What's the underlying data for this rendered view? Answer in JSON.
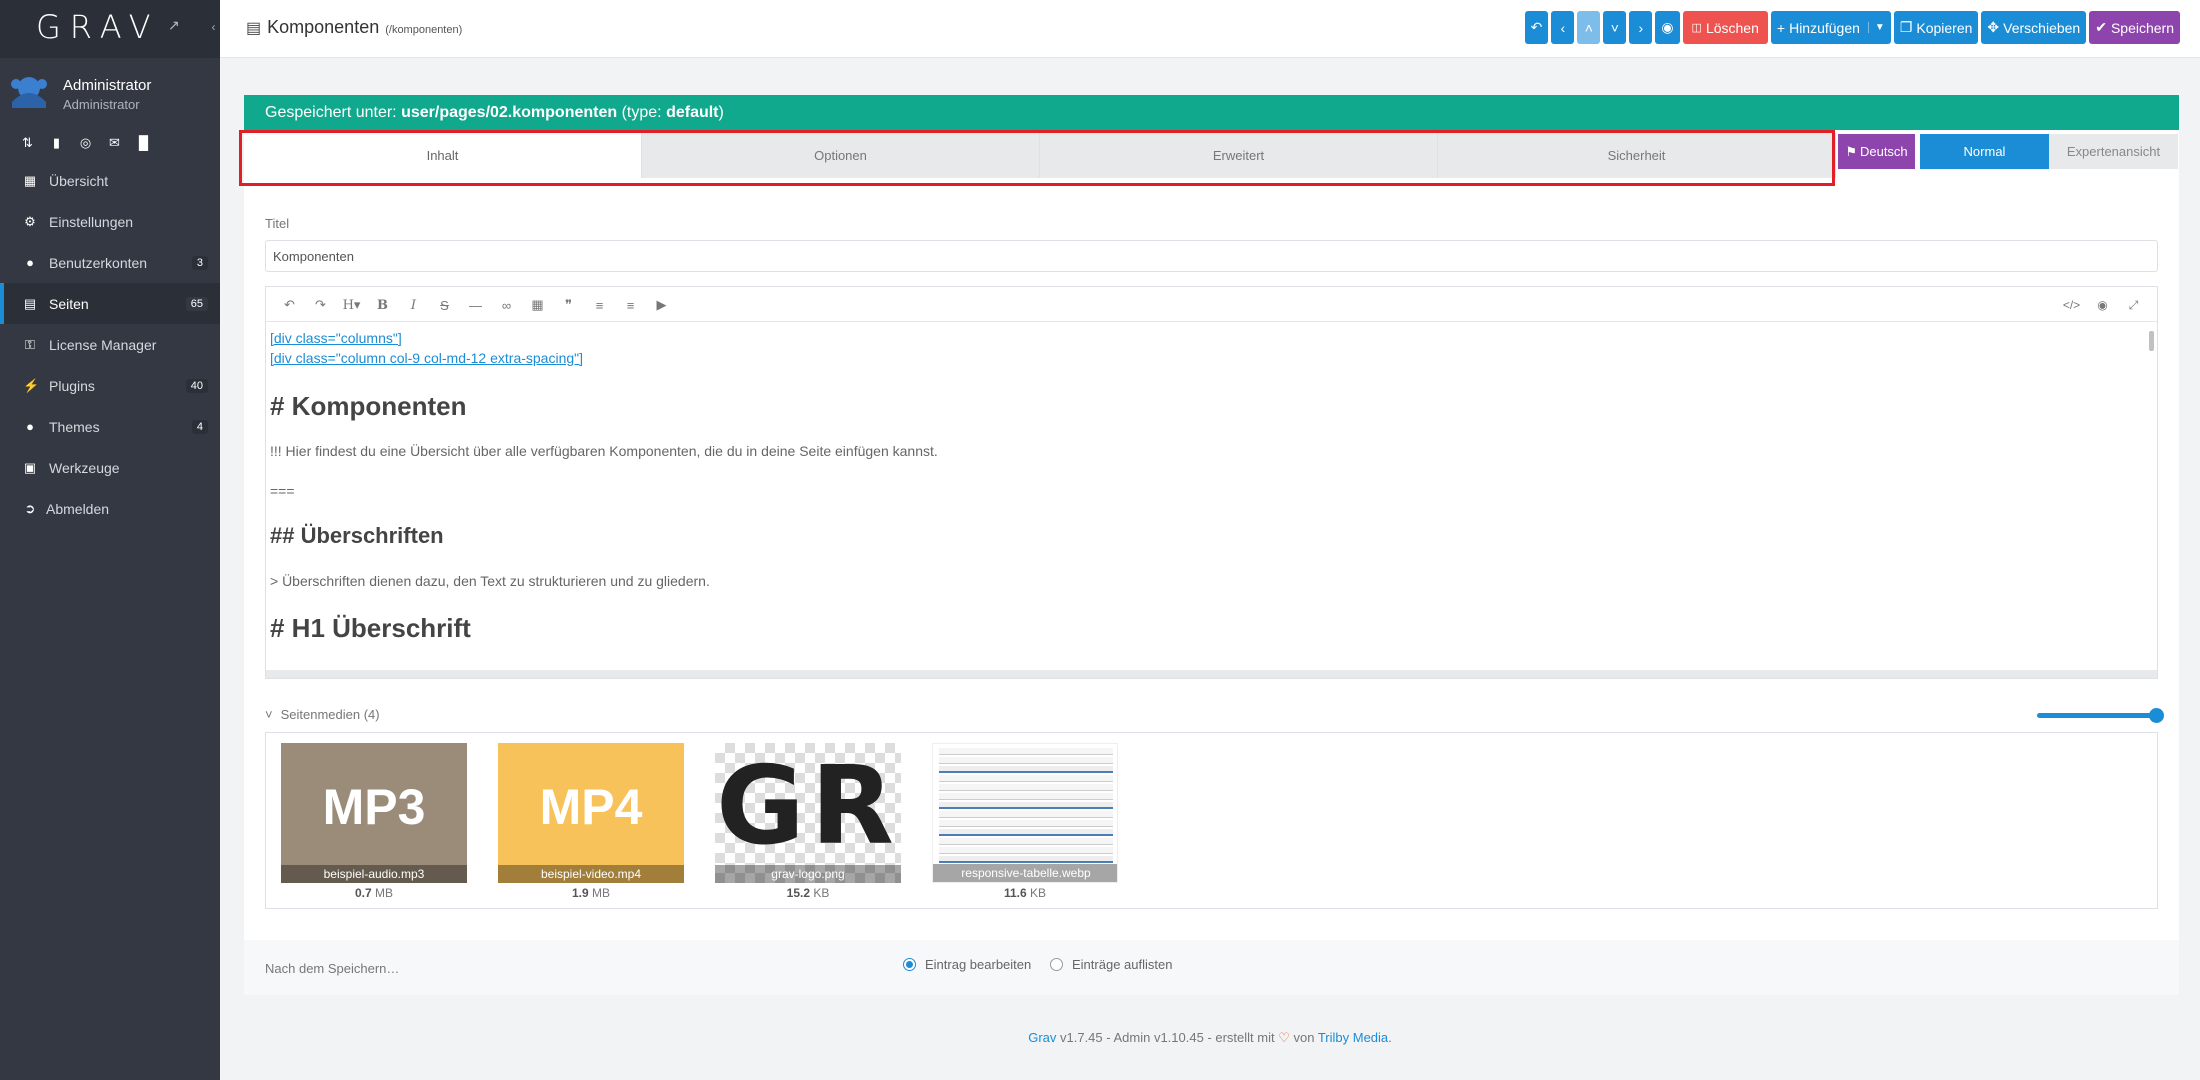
{
  "sidebar": {
    "logo": "GRAV",
    "user": {
      "name": "Administrator",
      "role": "Administrator"
    },
    "quick_icons": [
      "refresh-icon",
      "book-icon",
      "globe-icon",
      "mail-icon",
      "fork-icon"
    ],
    "items": [
      {
        "label": "Übersicht",
        "icon": "grid-icon",
        "count": ""
      },
      {
        "label": "Einstellungen",
        "icon": "wrench-icon",
        "count": ""
      },
      {
        "label": "Benutzerkonten",
        "icon": "users-icon",
        "count": "3"
      },
      {
        "label": "Seiten",
        "icon": "file-icon",
        "count": "65",
        "active": true
      },
      {
        "label": "License Manager",
        "icon": "key-icon",
        "count": ""
      },
      {
        "label": "Plugins",
        "icon": "plug-icon",
        "count": "40"
      },
      {
        "label": "Themes",
        "icon": "tint-icon",
        "count": "4"
      },
      {
        "label": "Werkzeuge",
        "icon": "briefcase-icon",
        "count": ""
      },
      {
        "label": "Abmelden",
        "icon": "sign-out-icon",
        "count": ""
      }
    ]
  },
  "topbar": {
    "title": "Komponenten",
    "route": "(/komponenten)",
    "buttons": {
      "delete": "Löschen",
      "add": "Hinzufügen",
      "copy": "Kopieren",
      "move": "Verschieben",
      "save": "Speichern"
    }
  },
  "saved": {
    "prefix": "Gespeichert unter:",
    "path": "user/pages/02.komponenten",
    "type_open": "(type:",
    "type": "default",
    "type_close": ")"
  },
  "tabs": [
    "Inhalt",
    "Optionen",
    "Erweitert",
    "Sicherheit"
  ],
  "language": "Deutsch",
  "modes": {
    "normal": "Normal",
    "expert": "Expertenansicht"
  },
  "title_field": {
    "label": "Titel",
    "value": "Komponenten"
  },
  "editor": {
    "lines": [
      {
        "type": "link",
        "text": "[div class=\"columns\"]"
      },
      {
        "type": "link",
        "text": "[div class=\"column col-9 col-md-12 extra-spacing\"]"
      },
      {
        "type": "h1",
        "text": "# Komponenten"
      },
      {
        "type": "p",
        "text": "!!! Hier findest du eine Übersicht über alle verfügbaren Komponenten, die du in deine Seite einfügen kannst."
      },
      {
        "type": "p",
        "text": "==="
      },
      {
        "type": "h2",
        "text": "## Überschriften"
      },
      {
        "type": "p",
        "text": "> Überschriften dienen dazu, den Text zu strukturieren und zu gliedern."
      },
      {
        "type": "h1",
        "text": "# H1 Überschrift"
      }
    ]
  },
  "media": {
    "label": "Seitenmedien (4)",
    "items": [
      {
        "caption": "beispiel-audio.mp3",
        "badge": "MP3",
        "size_num": "0.7",
        "size_unit": "MB"
      },
      {
        "caption": "beispiel-video.mp4",
        "badge": "MP4",
        "size_num": "1.9",
        "size_unit": "MB"
      },
      {
        "caption": "grav-logo.png",
        "badge": "GR",
        "size_num": "15.2",
        "size_unit": "KB"
      },
      {
        "caption": "responsive-tabelle.webp",
        "badge": "",
        "size_num": "11.6",
        "size_unit": "KB"
      }
    ]
  },
  "after_save": {
    "label": "Nach dem Speichern…",
    "opt1": "Eintrag bearbeiten",
    "opt2": "Einträge auflisten"
  },
  "footer": {
    "grav": "Grav",
    "text1": " v1.7.45 - Admin v1.10.45 - erstellt mit ",
    "text2": " von ",
    "trilby": "Trilby Media",
    "dot": "."
  },
  "colors": {
    "accent": "#1b8dd6",
    "teal": "#11a98e",
    "danger": "#ef5350",
    "purple": "#8e44ad",
    "sidebar": "#343842"
  }
}
